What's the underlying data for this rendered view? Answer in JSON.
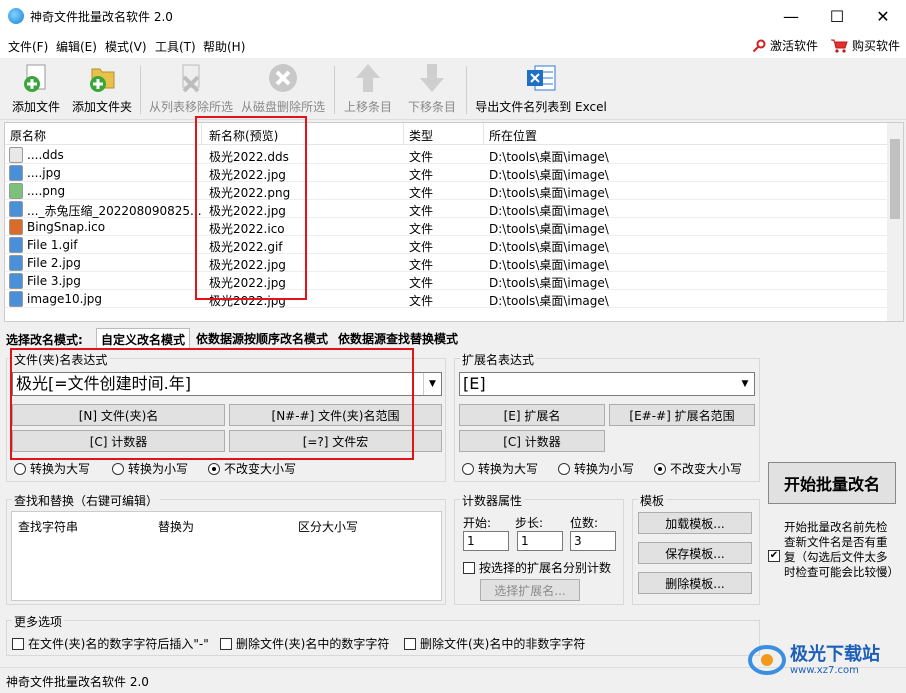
{
  "window": {
    "title": "神奇文件批量改名软件 2.0",
    "minimize": "—",
    "maximize": "☐",
    "close": "✕"
  },
  "menu": {
    "items": [
      "文件(F)",
      "编辑(E)",
      "模式(V)",
      "工具(T)",
      "帮助(H)"
    ],
    "activate": "激活软件",
    "buy": "购买软件"
  },
  "toolbar": {
    "add_file": "添加文件",
    "add_folder": "添加文件夹",
    "remove_from_list": "从列表移除所选",
    "delete_from_disk": "从磁盘删除所选",
    "move_up": "上移条目",
    "move_down": "下移条目",
    "export_excel": "导出文件名列表到 Excel"
  },
  "file_list": {
    "columns": [
      "原名称",
      "新名称(预览)",
      "类型",
      "所在位置"
    ],
    "rows": [
      {
        "icon": "dds-file-icon",
        "original": "....dds",
        "new": "极光2022.dds",
        "type": "文件",
        "location": "D:\\tools\\桌面\\image\\"
      },
      {
        "icon": "jpg-file-icon",
        "original": "....jpg",
        "new": "极光2022.jpg",
        "type": "文件",
        "location": "D:\\tools\\桌面\\image\\"
      },
      {
        "icon": "png-file-icon",
        "original": "....png",
        "new": "极光2022.png",
        "type": "文件",
        "location": "D:\\tools\\桌面\\image\\"
      },
      {
        "icon": "jpg-file-icon",
        "original": "..._赤兔压缩_202208090825...",
        "new": "极光2022.jpg",
        "type": "文件",
        "location": "D:\\tools\\桌面\\image\\"
      },
      {
        "icon": "ico-file-icon",
        "original": "BingSnap.ico",
        "new": "极光2022.ico",
        "type": "文件",
        "location": "D:\\tools\\桌面\\image\\"
      },
      {
        "icon": "gif-file-icon",
        "original": "File 1.gif",
        "new": "极光2022.gif",
        "type": "文件",
        "location": "D:\\tools\\桌面\\image\\"
      },
      {
        "icon": "jpg-file-icon",
        "original": "File 2.jpg",
        "new": "极光2022.jpg",
        "type": "文件",
        "location": "D:\\tools\\桌面\\image\\"
      },
      {
        "icon": "jpg-file-icon",
        "original": "File 3.jpg",
        "new": "极光2022.jpg",
        "type": "文件",
        "location": "D:\\tools\\桌面\\image\\"
      },
      {
        "icon": "jpg-file-icon",
        "original": "image10.jpg",
        "new": "极光2022.jpg",
        "type": "文件",
        "location": "D:\\tools\\桌面\\image\\"
      }
    ]
  },
  "mode": {
    "label": "选择改名模式:",
    "tabs": [
      "自定义改名模式",
      "依数据源按顺序改名模式",
      "依数据源查找替换模式"
    ],
    "active": 0
  },
  "name_expr": {
    "label": "文件(夹)名表达式",
    "value": "极光[=文件创建时间.年]",
    "buttons": [
      "[N] 文件(夹)名",
      "[N#-#] 文件(夹)名范围",
      "[C] 计数器",
      "[=?] 文件宏"
    ],
    "case_options": [
      "转换为大写",
      "转换为小写",
      "不改变大小写"
    ],
    "case_selected": 2
  },
  "ext_expr": {
    "label": "扩展名表达式",
    "value": "[E]",
    "buttons": [
      "[E] 扩展名",
      "[E#-#] 扩展名范围",
      "[C] 计数器"
    ],
    "case_options": [
      "转换为大写",
      "转换为小写",
      "不改变大小写"
    ],
    "case_selected": 2
  },
  "start_button": "开始批量改名",
  "check_duplicates": {
    "checked": true,
    "label": "开始批量改名前先检查新文件名是否有重复（勾选后文件太多时检查可能会比较慢）"
  },
  "find_replace": {
    "label": "查找和替换（右键可编辑）",
    "columns": [
      "查找字符串",
      "替换为",
      "区分大小写"
    ]
  },
  "counter": {
    "label": "计数器属性",
    "start_label": "开始:",
    "start": "1",
    "step_label": "步长:",
    "step": "1",
    "digits_label": "位数:",
    "digits": "3",
    "per_ext_label": "按选择的扩展名分别计数",
    "select_ext": "选择扩展名..."
  },
  "template": {
    "label": "模板",
    "load": "加载模板...",
    "save": "保存模板...",
    "delete": "删除模板..."
  },
  "more_options": {
    "label": "更多选项",
    "items": [
      "在文件(夹)名的数字字符后插入\"-\"",
      "删除文件(夹)名中的数字字符",
      "删除文件(夹)名中的非数字字符"
    ]
  },
  "status": {
    "text": "神奇文件批量改名软件 2.0"
  },
  "watermark": {
    "brand": "极光下载站",
    "url": "www.xz7.com"
  },
  "colors": {
    "highlight": "#e2141a",
    "accent": "#1a7fd6"
  }
}
